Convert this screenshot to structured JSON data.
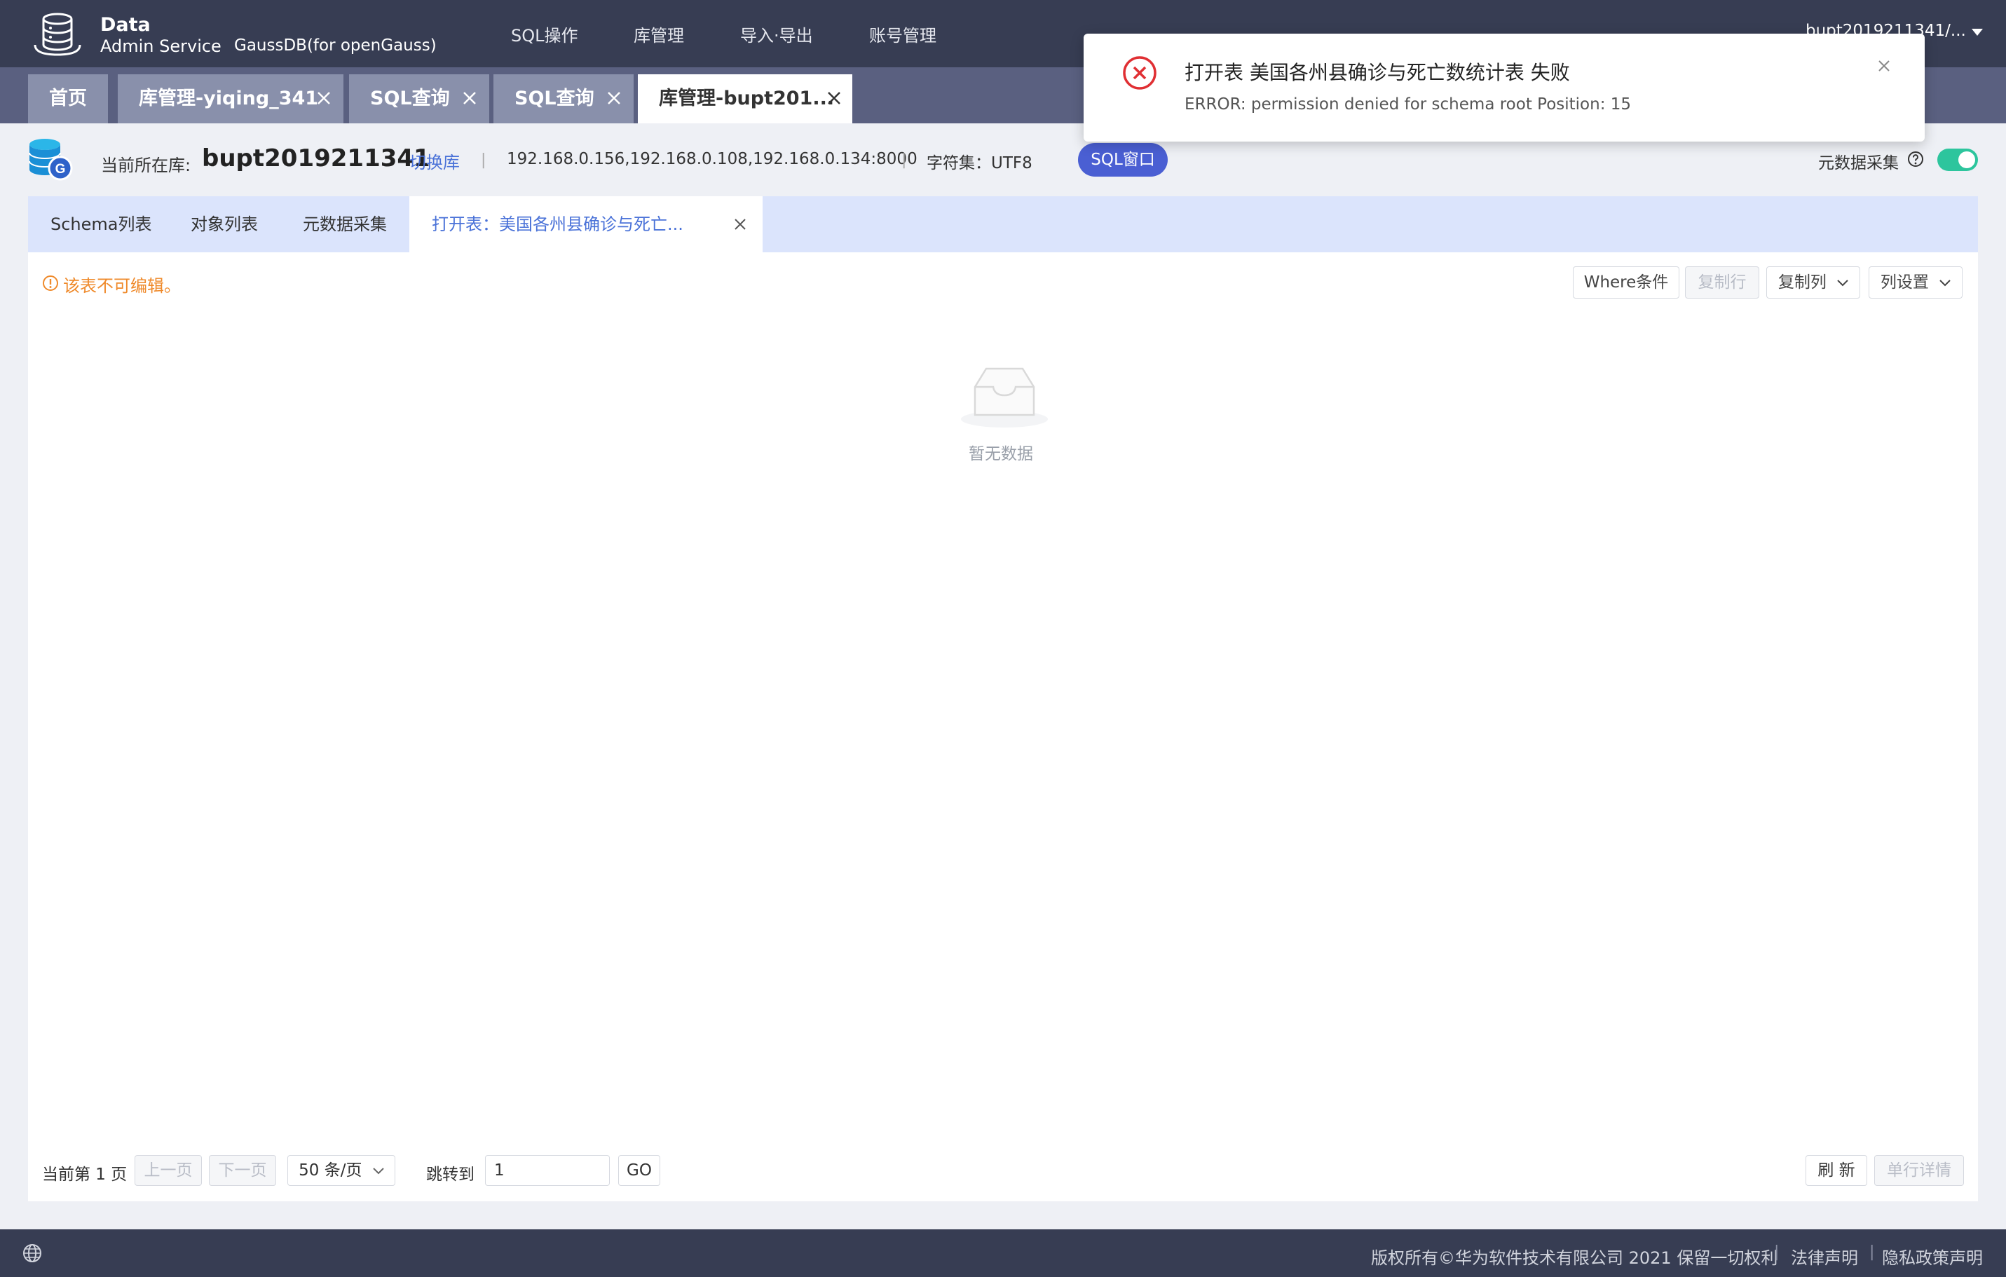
{
  "header": {
    "brand_title": "Data",
    "brand_subtitle": "Admin Service",
    "product": "GaussDB(for openGauss)",
    "nav": [
      "SQL操作",
      "库管理",
      "导入·导出",
      "账号管理"
    ],
    "user": "bupt2019211341/..."
  },
  "tabs": [
    {
      "label": "首页",
      "closable": false,
      "active": false
    },
    {
      "label": "库管理-yiqing_341",
      "closable": true,
      "active": false
    },
    {
      "label": "SQL查询",
      "closable": true,
      "active": false
    },
    {
      "label": "SQL查询",
      "closable": true,
      "active": false
    },
    {
      "label": "库管理-bupt201...",
      "closable": true,
      "active": true
    }
  ],
  "db_info": {
    "label": "当前所在库:",
    "name": "bupt2019211341",
    "switch_label": "切换库",
    "hosts": "192.168.0.156,192.168.0.108,192.168.0.134:8000",
    "charset": "字符集：UTF8",
    "sql_window_label": "SQL窗口",
    "meta_collect_label": "元数据采集",
    "meta_collect_enabled": true
  },
  "sub_tabs": [
    {
      "label": "Schema列表",
      "active": false
    },
    {
      "label": "对象列表",
      "active": false
    },
    {
      "label": "元数据采集",
      "active": false
    },
    {
      "label": "打开表：美国各州县确诊与死亡...",
      "active": true
    }
  ],
  "warning": "该表不可编辑。",
  "toolbar": {
    "where": "Where条件",
    "copy_row": "复制行",
    "copy_col": "复制列",
    "col_settings": "列设置"
  },
  "empty_text": "暂无数据",
  "pagination": {
    "current_page_text": "当前第 1 页",
    "prev": "上一页",
    "next": "下一页",
    "page_size": "50 条/页",
    "jump_label": "跳转到",
    "jump_value": "1",
    "go": "GO",
    "refresh": "刷 新",
    "row_detail": "单行详情"
  },
  "footer": {
    "copyright": "版权所有©华为软件技术有限公司 2021 保留一切权利",
    "legal": "法律声明",
    "privacy": "隐私政策声明"
  },
  "notification": {
    "title": "打开表 美国各州县确诊与死亡数统计表 失败",
    "message": "ERROR: permission denied for schema root Position: 15"
  },
  "colors": {
    "header_bg": "#373d53",
    "tab_strip_bg": "#5a6080",
    "accent": "#4a72d8",
    "sql_button": "#4a5fd3",
    "toggle_on": "#2dc59d",
    "warning": "#ef8a2b",
    "error": "#e02f33"
  }
}
